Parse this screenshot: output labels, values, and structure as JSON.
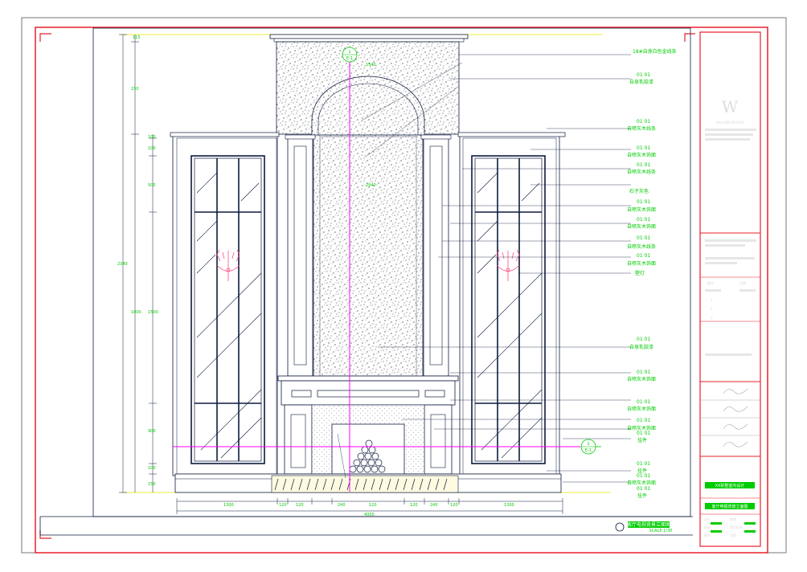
{
  "sheet": {
    "title": "客厅电视背景立面图",
    "scale_note": "SCALE:1/30",
    "section_marker": {
      "number": "1",
      "sheet": "E-1"
    },
    "elevation_marker": {
      "number": "1",
      "sheet": "E-1"
    }
  },
  "annotations": [
    "18#自身白色金线条",
    "01 01",
    "自身乳胶漆",
    "01 01",
    "自喷灰木线条",
    "01 01",
    "自喷灰木饰面",
    "01 01",
    "自喷灰木线条",
    "石子灰色",
    "01 01",
    "自喷灰木饰面",
    "01 01",
    "自喷灰木饰面",
    "01 01",
    "自喷灰木线条",
    "01 01",
    "自喷灰木饰面",
    "壁灯",
    "01 01",
    "自身乳胶漆",
    "01 01",
    "自喷灰木饰面",
    "01 01",
    "自喷灰木饰面",
    "01 01",
    "自喷灰木饰面",
    "01 01",
    "挂件",
    "01 01",
    "挂件",
    "01 01",
    "自喷灰木饰面",
    "01 01",
    "挂件"
  ],
  "dimensions": {
    "top": [
      "115",
      "1340"
    ],
    "left": [
      "150",
      "2340",
      "1000",
      "2940"
    ],
    "left_inner": [
      "100",
      "100",
      "505",
      "1500",
      "900",
      "100",
      "150"
    ],
    "bottom": [
      "1300",
      "120",
      "120",
      "240",
      "120",
      "120",
      "240",
      "120",
      "1300",
      "4000"
    ]
  },
  "title_block": {
    "logo_letter": "W",
    "company": "WILLIAM DESIGN",
    "rows": [
      "版次",
      "日期",
      "1",
      "2",
      "3"
    ],
    "project": "XX别墅室内设计",
    "drawing_name": "客厅电视背景立面图",
    "labels": [
      "设计",
      "审核",
      "校对",
      "项目负责",
      "图号",
      "比例"
    ]
  },
  "colors": {
    "border": "#e8202a",
    "lines": "#0d1b3e",
    "annotation": "#00cc00",
    "axis": "#ff00ff",
    "light": "#ff4d80",
    "stone": "#1a1a1a"
  }
}
